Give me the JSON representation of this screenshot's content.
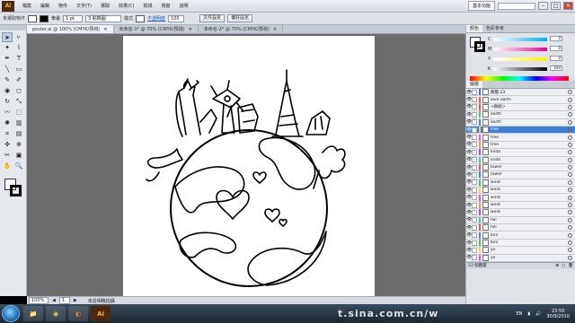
{
  "menubar": {
    "app_icon": "Ai",
    "items": [
      "檔案",
      "編輯",
      "物件",
      "文字(T)",
      "選取",
      "效果(C)",
      "檢視",
      "視窗",
      "說明"
    ],
    "workspace": "基本功能",
    "window_min": "–",
    "window_max": "□",
    "window_close": "✕"
  },
  "control_bar": {
    "selection_label": "未選取物件",
    "stroke_label": "筆畫",
    "stroke_weight": "1 pt",
    "brush": "3 點橢圓",
    "style_label": "樣式",
    "opacity_label": "不透明度",
    "opacity_value": "100",
    "doc_setup": "文件設定",
    "prefs": "偏好設定"
  },
  "tabs": [
    {
      "label": "poster.ai @ 100% (CMYK/預視)",
      "close": "✕",
      "active": true
    },
    {
      "label": "未命名-1* @ 70% (CMYK/預視)",
      "close": "✕",
      "active": false
    },
    {
      "label": "未命名-2* @ 70% (CMYK/預視)",
      "close": "✕",
      "active": false
    }
  ],
  "tools": [
    "selection-tool",
    "direct-selection-tool",
    "magic-wand-tool",
    "lasso-tool",
    "pen-tool",
    "type-tool",
    "line-tool",
    "rectangle-tool",
    "paintbrush-tool",
    "pencil-tool",
    "blob-brush-tool",
    "eraser-tool",
    "rotate-tool",
    "scale-tool",
    "warp-tool",
    "free-transform-tool",
    "symbol-sprayer-tool",
    "graph-tool",
    "mesh-tool",
    "gradient-tool",
    "eyedropper-tool",
    "blend-tool",
    "slice-tool",
    "artboard-tool",
    "hand-tool",
    "zoom-tool"
  ],
  "tool_glyphs": [
    "➤",
    "▹",
    "✦",
    "⌇",
    "✒",
    "T",
    "╲",
    "▭",
    "✎",
    "✐",
    "◉",
    "◻",
    "↻",
    "⤡",
    "〰",
    "⬚",
    "✺",
    "▥",
    "⌗",
    "▤",
    "✜",
    "⊕",
    "✂",
    "▣",
    "✋",
    "🔍"
  ],
  "right_panel": {
    "tabs": [
      {
        "label": "顏色",
        "active": true
      },
      {
        "label": "色彩參考",
        "active": false
      }
    ],
    "color_channels": [
      {
        "name": "C",
        "value": "0"
      },
      {
        "name": "M",
        "value": "0"
      },
      {
        "name": "Y",
        "value": "0"
      },
      {
        "name": "K",
        "value": "100"
      }
    ],
    "layers_tabs": [
      {
        "label": "圖層",
        "active": true
      }
    ],
    "layers": [
      {
        "name": "圖層 23",
        "selected": false,
        "color": "#4d7be0"
      },
      {
        "name": "love earth",
        "selected": false,
        "color": "#e05a5a"
      },
      {
        "name": "<群組>",
        "selected": false,
        "color": "#e05a5a"
      },
      {
        "name": "earth",
        "selected": false,
        "color": "#4dc06a"
      },
      {
        "name": "earth",
        "selected": false,
        "color": "#4d7be0"
      },
      {
        "name": "tree",
        "selected": true,
        "color": "#f0d04d"
      },
      {
        "name": "tree",
        "selected": false,
        "color": "#e05ae0"
      },
      {
        "name": "tree",
        "selected": false,
        "color": "#e0a04d"
      },
      {
        "name": "linda",
        "selected": false,
        "color": "#a04de0"
      },
      {
        "name": "linda",
        "selected": false,
        "color": "#4dc0c0"
      },
      {
        "name": "tower",
        "selected": false,
        "color": "#e05a5a"
      },
      {
        "name": "tower",
        "selected": false,
        "color": "#4d7be0"
      },
      {
        "name": "wind",
        "selected": false,
        "color": "#4dc06a"
      },
      {
        "name": "wind",
        "selected": false,
        "color": "#f0d04d"
      },
      {
        "name": "wind",
        "selected": false,
        "color": "#e05ae0"
      },
      {
        "name": "wind",
        "selected": false,
        "color": "#e0a04d"
      },
      {
        "name": "wind",
        "selected": false,
        "color": "#a04de0"
      },
      {
        "name": "hill",
        "selected": false,
        "color": "#4dc0c0"
      },
      {
        "name": "hill",
        "selected": false,
        "color": "#e05a5a"
      },
      {
        "name": "birc",
        "selected": false,
        "color": "#4d7be0"
      },
      {
        "name": "birc",
        "selected": false,
        "color": "#4dc06a"
      },
      {
        "name": "yo",
        "selected": false,
        "color": "#f0d04d"
      },
      {
        "name": "yo",
        "selected": false,
        "color": "#e05ae0"
      }
    ],
    "layers_footer": "23 個圖層"
  },
  "status": {
    "zoom": "100%",
    "page": "1",
    "info": "未從相機拍攝"
  },
  "taskbar": {
    "lang": "EN",
    "time": "23:50",
    "date": "30/9/2010",
    "apps": [
      {
        "name": "windows-explorer",
        "glyph": "📁",
        "color": "#f2c14e"
      },
      {
        "name": "chrome",
        "glyph": "◉",
        "color": "#e8d24a"
      },
      {
        "name": "firefox",
        "glyph": "◐",
        "color": "#f07a2a"
      },
      {
        "name": "illustrator",
        "glyph": "Ai",
        "color": "#ffb43a"
      }
    ]
  },
  "watermark": "t.sina.com.cn/w"
}
